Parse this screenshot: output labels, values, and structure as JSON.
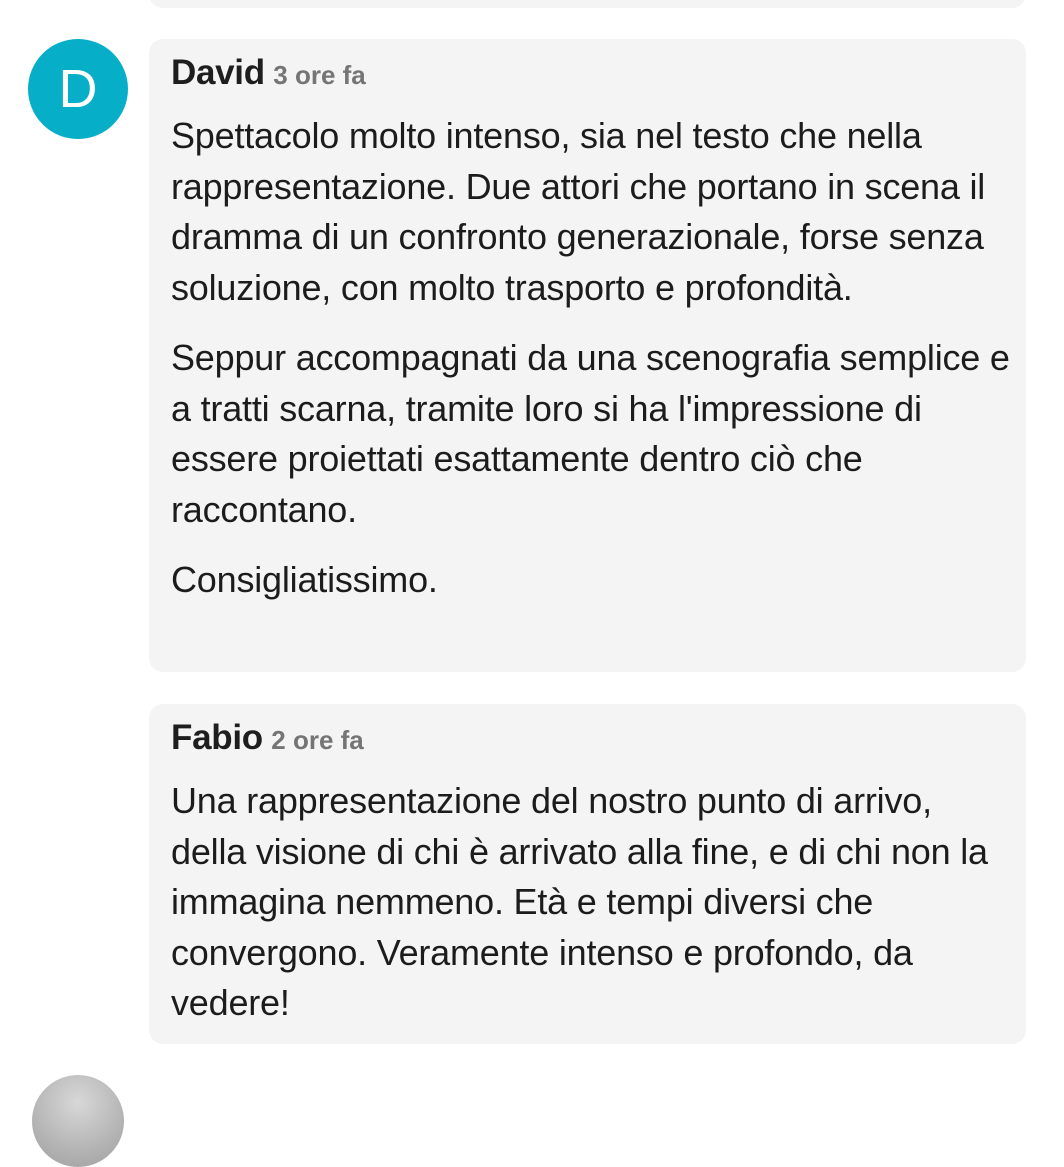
{
  "comments": [
    {
      "avatar_initial": "D",
      "avatar_color": "#07aec8",
      "author": "David",
      "time": "3 ore fa",
      "paragraphs": [
        "Spettacolo molto intenso, sia nel testo che nella rappresentazione. Due attori che portano in scena il dramma di un confronto generazionale, forse senza soluzione, con molto trasporto e profondità.",
        "Seppur accompagnati da una scenografia semplice e a tratti scarna, tramite loro si ha l'impressione di essere proiettati esattamente dentro ciò che raccontano.",
        "Consigliatissimo."
      ]
    },
    {
      "author": "Fabio",
      "time": "2 ore fa",
      "paragraphs": [
        "Una rappresentazione del nostro punto di arrivo, della visione di chi è arrivato alla fine, e di chi non la immagina nemmeno. Età e tempi diversi che convergono. Veramente intenso e profondo, da vedere!"
      ]
    }
  ]
}
